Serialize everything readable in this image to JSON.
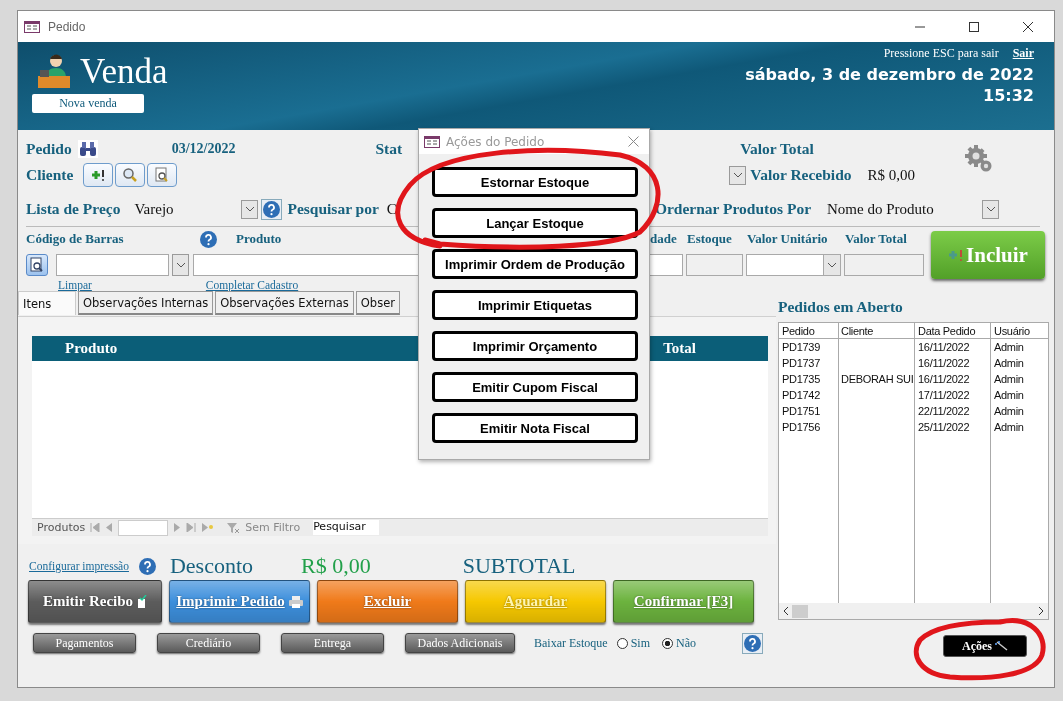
{
  "window": {
    "title": "Pedido"
  },
  "header": {
    "title": "Venda",
    "new_button": "Nova venda",
    "hint": "Pressione ESC para sair",
    "exit_link": "Sair",
    "date": "sábado, 3 de dezembro de 2022",
    "time": "15:32"
  },
  "order": {
    "label": "Pedido",
    "date": "03/12/2022",
    "status_label": "Stat",
    "total_label": "Valor Total",
    "client_label": "Cliente",
    "received_label": "Valor Recebido",
    "received_value": "R$ 0,00",
    "price_list_label": "Lista de Preço",
    "price_list_value": "Varejo",
    "search_by_label": "Pesquisar por",
    "search_by_value": "C",
    "sort_label": "Ordernar Produtos Por",
    "sort_value": "Nome do Produto"
  },
  "entry": {
    "barcode_label": "Código de Barras",
    "product_label": "Produto",
    "quantity_label": "dade",
    "stock_label": "Estoque",
    "unit_price_label": "Valor Unitário",
    "total_label": "Valor Total",
    "add_button": "Incluir",
    "clear_link": "Limpar",
    "complete_link": "Completar Cadastro"
  },
  "tabs": [
    {
      "label": "Itens",
      "selected": true
    },
    {
      "label": "Observações Internas",
      "selected": false
    },
    {
      "label": "Observações Externas",
      "selected": false
    },
    {
      "label": "Obser",
      "selected": false
    }
  ],
  "items_table": {
    "columns": [
      "Produto",
      "Total"
    ],
    "navigator_label": "Produtos",
    "filter": "Sem Filtro",
    "search": "Pesquisar"
  },
  "open_orders": {
    "title": "Pedidos em Aberto",
    "columns": [
      "Pedido",
      "Cliente",
      "Data Pedido",
      "Usuário"
    ],
    "rows": [
      [
        "PD1739",
        "",
        "16/11/2022",
        "Admin"
      ],
      [
        "PD1737",
        "",
        "16/11/2022",
        "Admin"
      ],
      [
        "PD1735",
        "DEBORAH SUI",
        "16/11/2022",
        "Admin"
      ],
      [
        "PD1742",
        "",
        "17/11/2022",
        "Admin"
      ],
      [
        "PD1751",
        "",
        "22/11/2022",
        "Admin"
      ],
      [
        "PD1756",
        "",
        "25/11/2022",
        "Admin"
      ]
    ]
  },
  "totals": {
    "print_config_link": "Configurar impressão",
    "discount_label": "Desconto",
    "discount_value": "R$ 0,00",
    "subtotal_label": "SUBTOTAL"
  },
  "action_buttons": [
    {
      "label": "Emitir Recibo",
      "kind": "receipt",
      "underlined": false
    },
    {
      "label": "Imprimir Pedido",
      "kind": "print",
      "underlined": true
    },
    {
      "label": "Excluir",
      "kind": "delete",
      "underlined": true
    },
    {
      "label": "Aguardar",
      "kind": "hold",
      "underlined": true
    },
    {
      "label": "Confirmar [F3]",
      "kind": "confirm",
      "underlined": true
    }
  ],
  "secondary_buttons": [
    "Pagamentos",
    "Crediário",
    "Entrega",
    "Dados Adicionais"
  ],
  "stock_option": {
    "label": "Baixar Estoque",
    "options": [
      {
        "label": "Sim",
        "selected": false
      },
      {
        "label": "Não",
        "selected": true
      }
    ]
  },
  "actions_button": "Ações",
  "dialog": {
    "title": "Ações do Pedido",
    "buttons": [
      "Estornar Estoque",
      "Lançar Estoque",
      "Imprimir Ordem de Produção",
      "Imprimir Etiquetas",
      "Imprimir Orçamento",
      "Emitir Cupom Fiscal",
      "Emitir Nota Fiscal"
    ]
  }
}
